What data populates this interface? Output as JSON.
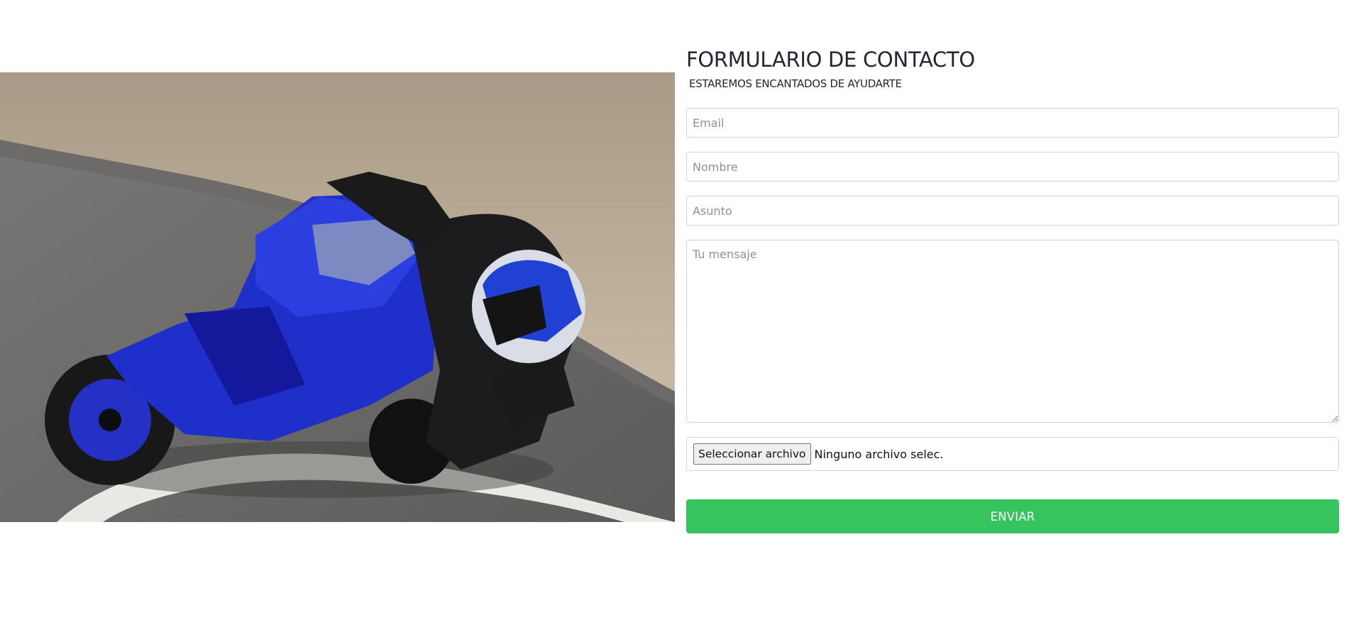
{
  "hero_image": {
    "alt": "motorcycle-racer-photo",
    "brand_colors": {
      "bike": "#1f2fc9",
      "asphalt": "#6f6e6c",
      "hillside": "#b8a890"
    }
  },
  "form": {
    "title": "FORMULARIO DE CONTACTO",
    "subtitle": "ESTAREMOS ENCANTADOS DE AYUDARTE",
    "email_placeholder": "Email",
    "name_placeholder": "Nombre",
    "subject_placeholder": "Asunto",
    "message_placeholder": "Tu mensaje",
    "file_button_label": "Seleccionar archivo",
    "file_status": "Ninguno archivo selec.",
    "submit_label": "ENVIAR",
    "submit_color": "#36c45e"
  }
}
